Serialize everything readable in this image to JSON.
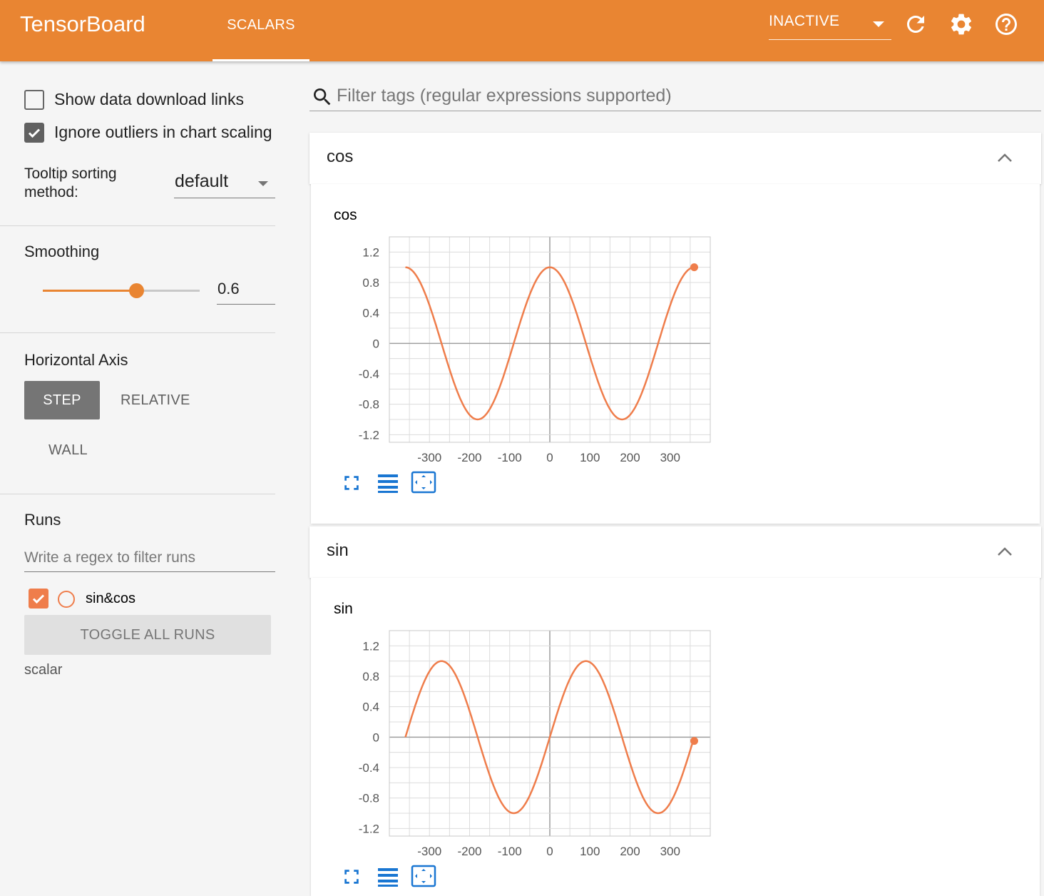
{
  "header": {
    "brand": "TensorBoard",
    "tab": "SCALARS",
    "status": "INACTIVE",
    "accent": "#e98532",
    "icons": [
      "refresh-icon",
      "settings-gear-icon",
      "help-icon"
    ]
  },
  "sidebar": {
    "show_download_label": "Show data download links",
    "show_download_checked": false,
    "ignore_outliers_label": "Ignore outliers in chart scaling",
    "ignore_outliers_checked": true,
    "tooltip_label_line1": "Tooltip sorting",
    "tooltip_label_line2": "method:",
    "tooltip_value": "default",
    "smoothing_label": "Smoothing",
    "smoothing_value": "0.6",
    "axis_label": "Horizontal Axis",
    "axis_options": [
      "STEP",
      "RELATIVE",
      "WALL"
    ],
    "axis_selected": "STEP",
    "runs_label": "Runs",
    "runs_filter_placeholder": "Write a regex to filter runs",
    "run_name": "sin&cos",
    "run_checked": true,
    "run_color": "#ef7d4b",
    "toggle_all": "TOGGLE ALL RUNS",
    "logdir": "scalar"
  },
  "main": {
    "filter_placeholder": "Filter tags (regular expressions supported)",
    "categories": [
      {
        "name": "cos",
        "card_title": "cos"
      },
      {
        "name": "sin",
        "card_title": "sin"
      }
    ]
  },
  "chart_data": [
    {
      "type": "line",
      "title": "cos",
      "xlim": [
        -400,
        400
      ],
      "ylim": [
        -1.3,
        1.4
      ],
      "x_ticks": [
        "-300",
        "-200",
        "-100",
        "0",
        "100",
        "200",
        "300"
      ],
      "y_ticks": [
        "1.2",
        "0.8",
        "0.4",
        "0",
        "-0.4",
        "-0.8",
        "-1.2"
      ],
      "series": [
        {
          "function": "cos(x degrees)",
          "x_range": [
            -360,
            360
          ],
          "color": "#ef7d4b",
          "last_point": [
            360,
            1.0
          ]
        }
      ]
    },
    {
      "type": "line",
      "title": "sin",
      "xlim": [
        -400,
        400
      ],
      "ylim": [
        -1.3,
        1.4
      ],
      "x_ticks": [
        "-300",
        "-200",
        "-100",
        "0",
        "100",
        "200",
        "300"
      ],
      "y_ticks": [
        "1.2",
        "0.8",
        "0.4",
        "0",
        "-0.4",
        "-0.8",
        "-1.2"
      ],
      "series": [
        {
          "function": "sin(x degrees)",
          "x_range": [
            -360,
            360
          ],
          "color": "#ef7d4b",
          "last_point": [
            360,
            -0.05
          ]
        }
      ]
    }
  ]
}
